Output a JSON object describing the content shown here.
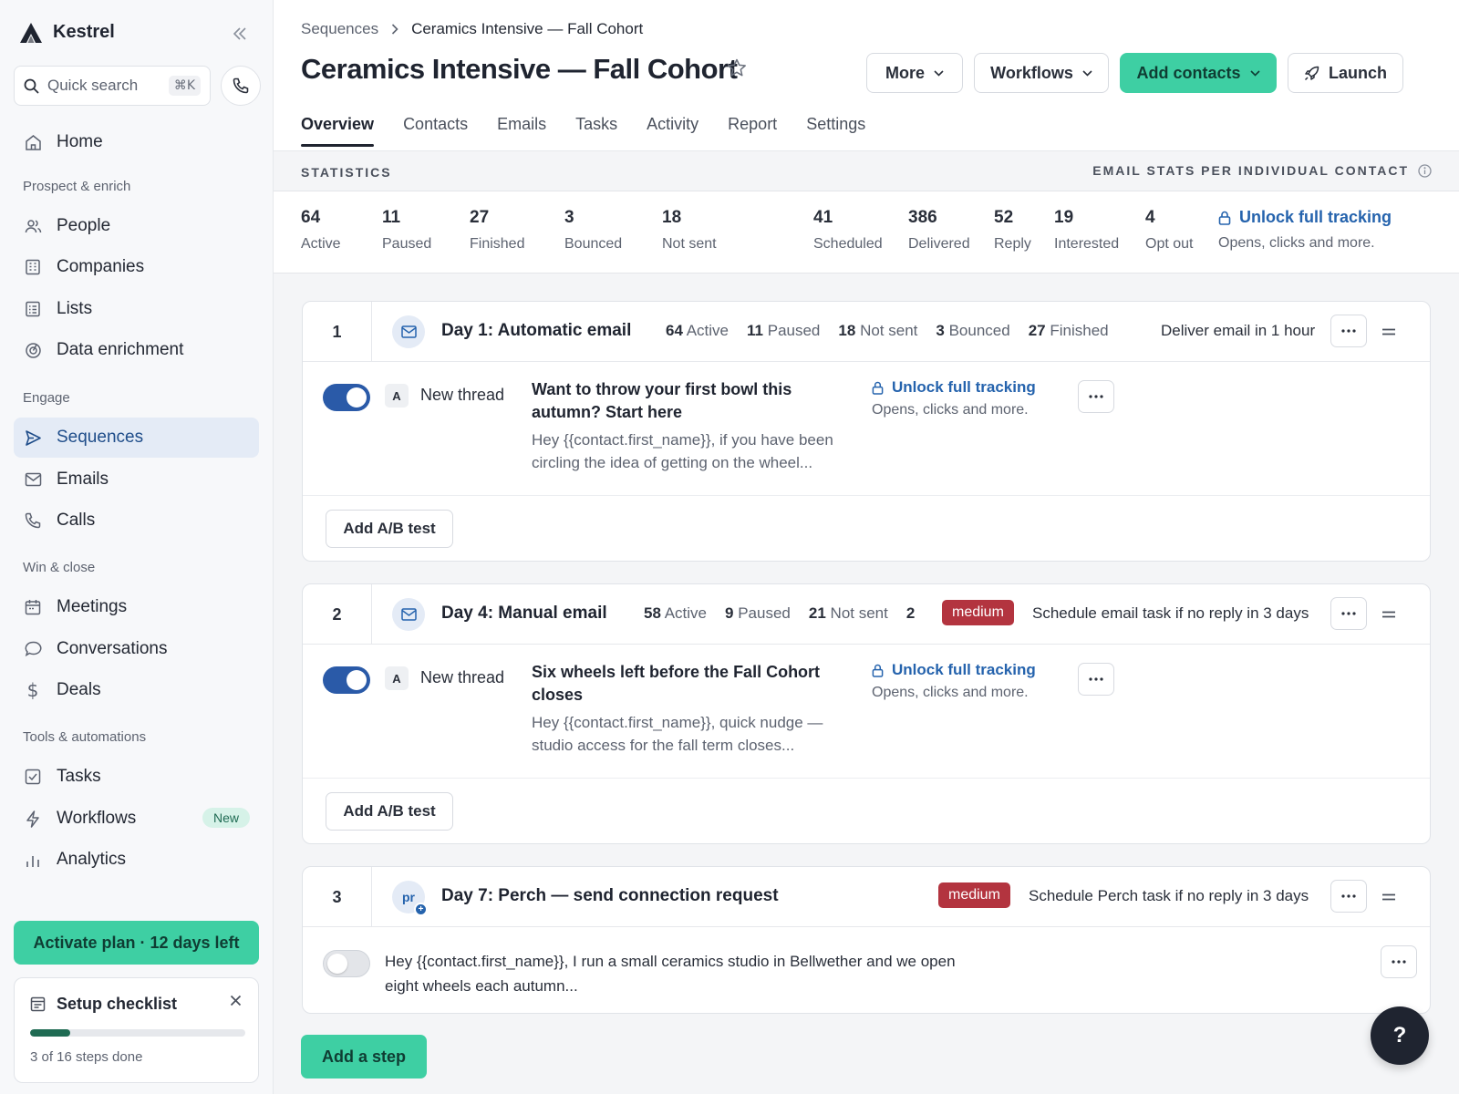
{
  "app": {
    "name": "Kestrel"
  },
  "search": {
    "placeholder": "Quick search",
    "shortcut": "⌘K"
  },
  "sidebar": {
    "home": "Home",
    "sections": {
      "prospect": "Prospect & enrich",
      "engage": "Engage",
      "win": "Win & close",
      "tools": "Tools & automations"
    },
    "items": {
      "people": "People",
      "companies": "Companies",
      "lists": "Lists",
      "enrichment": "Data enrichment",
      "sequences": "Sequences",
      "emails": "Emails",
      "calls": "Calls",
      "meetings": "Meetings",
      "conversations": "Conversations",
      "deals": "Deals",
      "tasks": "Tasks",
      "workflows": "Workflows",
      "analytics": "Analytics"
    },
    "workflows_badge": "New",
    "activate_label": "Activate plan · 12 days left",
    "checklist": {
      "title": "Setup checklist",
      "progress_text": "3 of 16 steps done",
      "done": 3,
      "total": 16
    }
  },
  "breadcrumb": {
    "parent": "Sequences",
    "current": "Ceramics Intensive — Fall Cohort"
  },
  "page_title": "Ceramics Intensive — Fall Cohort",
  "toolbar": {
    "more": "More",
    "workflows": "Workflows",
    "add_contacts": "Add contacts",
    "launch": "Launch"
  },
  "tabs": [
    "Overview",
    "Contacts",
    "Emails",
    "Tasks",
    "Activity",
    "Report",
    "Settings"
  ],
  "stats": {
    "header_left": "STATISTICS",
    "header_right": "EMAIL STATS PER INDIVIDUAL CONTACT",
    "items": [
      {
        "value": "64",
        "label": "Active"
      },
      {
        "value": "11",
        "label": "Paused"
      },
      {
        "value": "27",
        "label": "Finished"
      },
      {
        "value": "3",
        "label": "Bounced"
      },
      {
        "value": "18",
        "label": "Not sent"
      },
      {
        "value": "41",
        "label": "Scheduled"
      },
      {
        "value": "386",
        "label": "Delivered"
      },
      {
        "value": "52",
        "label": "Reply"
      },
      {
        "value": "19",
        "label": "Interested"
      },
      {
        "value": "4",
        "label": "Opt out"
      }
    ],
    "unlock_title": "Unlock full tracking",
    "unlock_sub": "Opens, clicks and more."
  },
  "steps": [
    {
      "number": "1",
      "title": "Day 1: Automatic email",
      "stats": [
        {
          "value": "64",
          "label": "Active"
        },
        {
          "value": "11",
          "label": "Paused"
        },
        {
          "value": "18",
          "label": "Not sent"
        },
        {
          "value": "3",
          "label": "Bounced"
        },
        {
          "value": "27",
          "label": "Finished"
        }
      ],
      "action": "Deliver email in 1 hour",
      "variant": "A",
      "thread": "New thread",
      "subject": "Want to throw your first bowl this autumn? Start here",
      "preview": "Hey {{contact.first_name}}, if you have been circling the idea of getting on the wheel...",
      "unlock_title": "Unlock full tracking",
      "unlock_sub": "Opens, clicks and more.",
      "ab_label": "Add A/B test",
      "enabled": true
    },
    {
      "number": "2",
      "title": "Day 4: Manual email",
      "stats": [
        {
          "value": "58",
          "label": "Active"
        },
        {
          "value": "9",
          "label": "Paused"
        },
        {
          "value": "21",
          "label": "Not sent"
        },
        {
          "value": "2",
          "label": ""
        }
      ],
      "priority": "medium",
      "action": "Schedule email task if no reply in 3 days",
      "variant": "A",
      "thread": "New thread",
      "subject": "Six wheels left before the Fall Cohort closes",
      "preview": "Hey {{contact.first_name}}, quick nudge — studio access for the fall term closes...",
      "unlock_title": "Unlock full tracking",
      "unlock_sub": "Opens, clicks and more.",
      "ab_label": "Add A/B test",
      "enabled": true
    },
    {
      "number": "3",
      "title": "Day 7: Perch — send connection request",
      "avatar": "pr",
      "priority": "medium",
      "action": "Schedule Perch task if no reply in 3 days",
      "body": "Hey {{contact.first_name}}, I run a small ceramics studio in Bellwether and we open eight wheels each autumn...",
      "enabled": false
    }
  ],
  "add_step": "Add a step",
  "help": "?",
  "colors": {
    "accent": "#3ecfa3",
    "link": "#2563ad",
    "priority": "#b3343f",
    "toggle_on": "#2a5aa8"
  }
}
